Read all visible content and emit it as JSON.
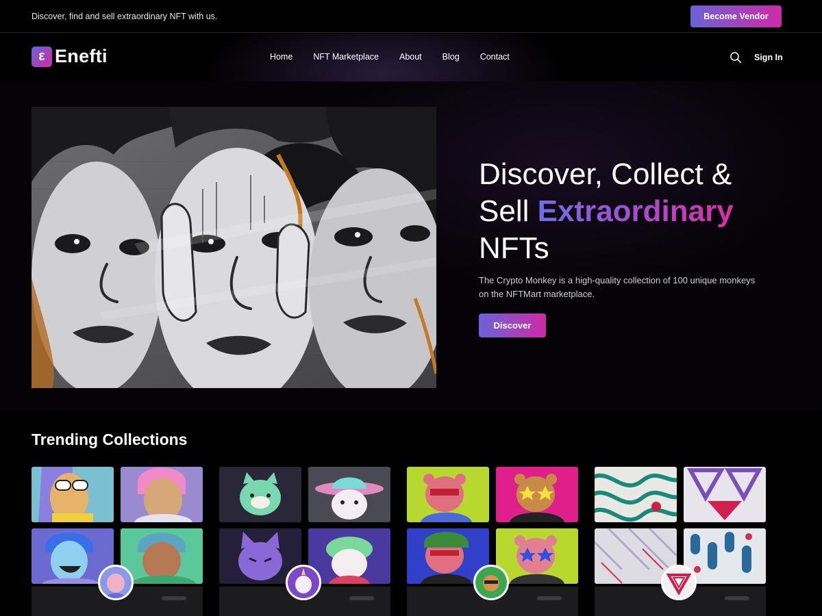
{
  "topbar": {
    "tagline": "Discover, find and sell extraordinary NFT with us.",
    "vendor_button": "Become Vendor"
  },
  "brand": {
    "logo_mark": "ε",
    "name": "Enefti"
  },
  "nav": {
    "items": [
      {
        "label": "Home"
      },
      {
        "label": "NFT Marketplace"
      },
      {
        "label": "About"
      },
      {
        "label": "Blog"
      },
      {
        "label": "Contact"
      }
    ],
    "search_icon": "search-icon",
    "signin": "Sign In"
  },
  "hero": {
    "title_line1": "Discover, Collect &",
    "title_line2_plain": "Sell ",
    "title_line2_highlight": "Extraordinary",
    "title_line3": "NFTs",
    "description": "The Crypto Monkey is a high-quality collection of 100 unique monkeys on the NFTMart marketplace.",
    "cta": "Discover",
    "image": "graffiti-faces-artwork"
  },
  "trending": {
    "title": "Trending Collections",
    "collections": [
      {
        "id": "cartoon-people",
        "thumbs": [
          "sunglasses-character",
          "pink-hair-character",
          "blue-hair-character",
          "beanie-character"
        ],
        "avatar": "cartoon-avatar"
      },
      {
        "id": "3d-pets",
        "thumbs": [
          "green-cat",
          "hat-bear",
          "purple-cat",
          "green-sheep"
        ],
        "avatar": "unicorn-avatar"
      },
      {
        "id": "punk-bears",
        "thumbs": [
          "red-bear-lime",
          "star-bear-magenta",
          "green-bear-blue",
          "star-bear-lime"
        ],
        "avatar": "bear-avatar"
      },
      {
        "id": "abstract-patterns",
        "thumbs": [
          "teal-curves",
          "purple-triangles",
          "diagonal-stripes",
          "blue-geometric"
        ],
        "avatar": "triangle-logo-avatar"
      }
    ]
  },
  "colors": {
    "background": "#000000",
    "gradient_start": "#6a63d6",
    "gradient_end": "#cf2aa6",
    "card_footer": "#1c1c1f"
  }
}
